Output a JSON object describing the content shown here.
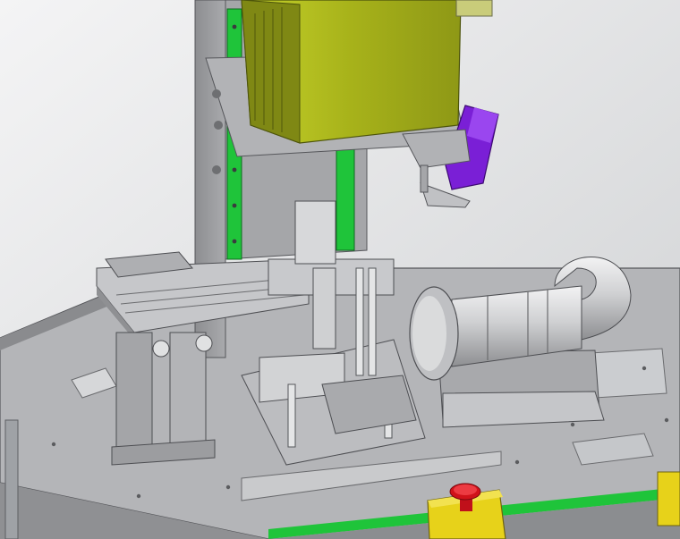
{
  "scene": {
    "kind": "3D CAD assembly rendering",
    "background": "#e4e5e6",
    "colors": {
      "plate": "#b3b4b7",
      "plate_dark": "#8a8b8e",
      "frame": "#9c9d9f",
      "rail_green": "#1fc43a",
      "motor_yellow_green": "#a7b21a",
      "motor_dark": "#7f8814",
      "actuator_purple": "#7a1fd6",
      "estop_red": "#d0121a",
      "estop_box": "#e7d21a",
      "metal_light": "#d9dadb",
      "metal_mid": "#b9babc"
    },
    "objects": [
      "base-plate",
      "vertical-column",
      "linear-rail",
      "spindle-motor",
      "gripper-actuator",
      "slide-table",
      "fixture-station",
      "suction-nozzle",
      "emergency-stop",
      "conveyor-rail"
    ]
  }
}
